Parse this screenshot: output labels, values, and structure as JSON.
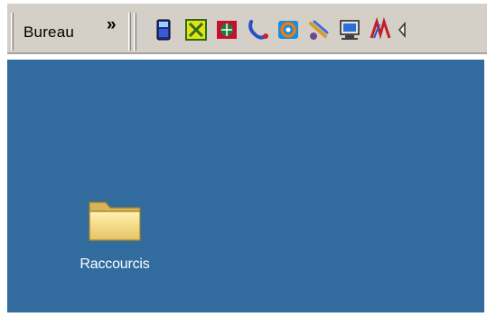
{
  "taskbar": {
    "toolbar_label": "Bureau",
    "chevron": "»",
    "quick_launch": [
      {
        "name": "phone-icon"
      },
      {
        "name": "excel-icon"
      },
      {
        "name": "network-globe-icon"
      },
      {
        "name": "dialer-icon"
      },
      {
        "name": "browser-icon"
      },
      {
        "name": "paint-icon"
      },
      {
        "name": "computer-icon"
      },
      {
        "name": "acrobat-icon"
      },
      {
        "name": "back-arrow-icon"
      }
    ]
  },
  "desktop": {
    "background": "#326c9e",
    "icons": [
      {
        "label": "Raccourcis",
        "icon": "folder-icon"
      }
    ]
  }
}
